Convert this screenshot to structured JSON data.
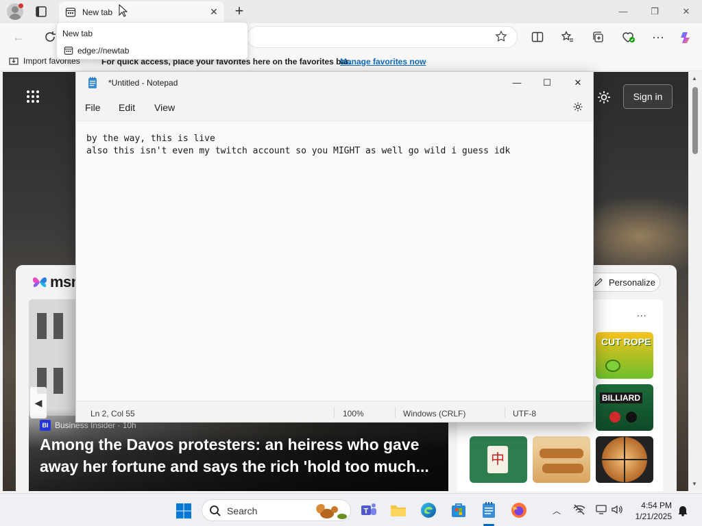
{
  "browser": {
    "tab": {
      "title": "New tab"
    },
    "tab_preview": {
      "title": "New tab",
      "url": "edge://newtab"
    },
    "favorites_bar": {
      "import_label": "Import favorites",
      "message": "For quick access, place your favorites here on the favorites bar.",
      "manage_link": "Manage favorites now"
    }
  },
  "msn_page": {
    "logo_text": "msn",
    "signin_label": "Sign in",
    "personalize_label": "Personalize",
    "hero": {
      "source_badge": "BI",
      "source": "Business Insider · 10h",
      "headline": "Among the Davos protesters: an heiress who gave away her fortune and says the rich 'hold too much..."
    },
    "games": {
      "more_label": "...",
      "items": [
        {
          "name": "Cut the Rope",
          "label": "CUT ROPE"
        },
        {
          "name": "8 Ball Billiard",
          "label": "BILLIARD"
        },
        {
          "name": "Mahjong",
          "label": "中"
        },
        {
          "name": "Wood Nuts",
          "label": ""
        },
        {
          "name": "Deer Hunter",
          "label": ""
        }
      ]
    }
  },
  "notepad": {
    "title": "*Untitled - Notepad",
    "menu": {
      "file": "File",
      "edit": "Edit",
      "view": "View"
    },
    "content": "by the way, this is live\nalso this isn't even my twitch account so you MIGHT as well go wild i guess idk",
    "status": {
      "position": "Ln 2, Col 55",
      "zoom": "100%",
      "line_ending": "Windows (CRLF)",
      "encoding": "UTF-8"
    }
  },
  "taskbar": {
    "search_placeholder": "Search",
    "clock": {
      "time": "4:54 PM",
      "date": "1/21/2025"
    }
  },
  "colors": {
    "accent": "#0067c0",
    "link": "#0f6cbd",
    "bi_badge": "#2536d6"
  },
  "icons": {
    "tab": "newtab-icon",
    "star": "favorite-star-icon",
    "settings": "gear-icon",
    "search": "search-icon"
  }
}
